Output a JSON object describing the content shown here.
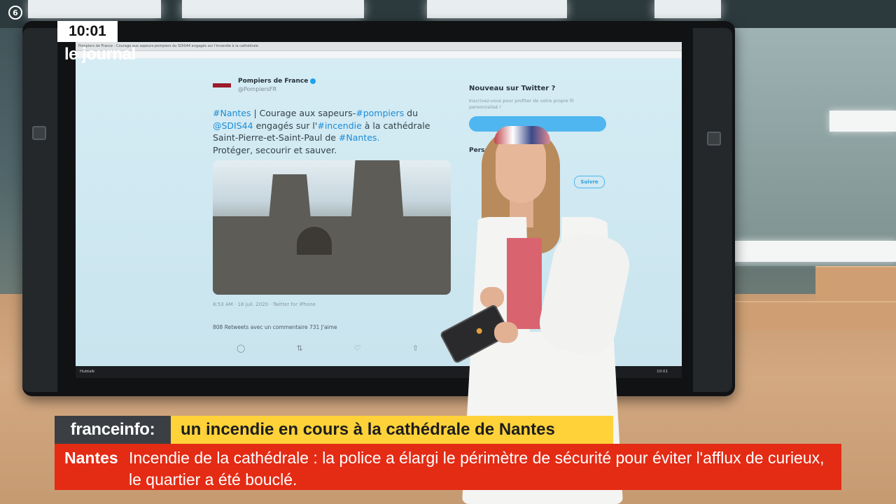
{
  "overlay": {
    "clock": "10:01",
    "show_name": "le journal",
    "corner_logo": "6"
  },
  "display": {
    "browser_tab": "Pompiers de France - Courage aux sapeurs-pompiers du SDIS44 engagés sur l'incendie à la cathédrale",
    "tweet": {
      "author_name": "Pompiers de France",
      "author_handle": "@PompiersFR",
      "text_parts": {
        "h_nantes": "#Nantes",
        "t1": " | Courage aux sapeurs-",
        "h_pompiers": "#pompiers",
        "t2": " du ",
        "h_sdis": "@SDIS44",
        "t3": " engagés sur l'",
        "h_incendie": "#incendie",
        "t4": " à la cathédrale Saint-Pierre-et-Saint-Paul de ",
        "h_nantes2": "#Nantes.",
        "t5": "Protéger, secourir et sauver."
      },
      "meta": "8:53 AM · 18 juil. 2020 · Twitter for iPhone",
      "stats": "808 Retweets avec un commentaire   731 J'aime"
    },
    "sidebar": {
      "title": "Nouveau sur Twitter ?",
      "note": "Inscrivez-vous pour profiter de votre propre fil personnalisé !",
      "sub_title": "Perso",
      "follow_label": "Suivre"
    },
    "taskbar": {
      "app_label": "Hubtalk",
      "time": "10:01"
    }
  },
  "lower_third": {
    "brand": "franceinfo:",
    "headline": "un incendie en cours à la cathédrale de Nantes",
    "ticker_label": "Nantes",
    "ticker_text": "Incendie de la cathédrale : la police a élargi le périmètre de sécurité pour éviter l'afflux de curieux, le quartier a été bouclé."
  },
  "colors": {
    "brand_bg": "#3b3f44",
    "headline_bg": "#ffd23a",
    "ticker_bg": "#e42b14",
    "hashtag": "#1a8cd8"
  }
}
